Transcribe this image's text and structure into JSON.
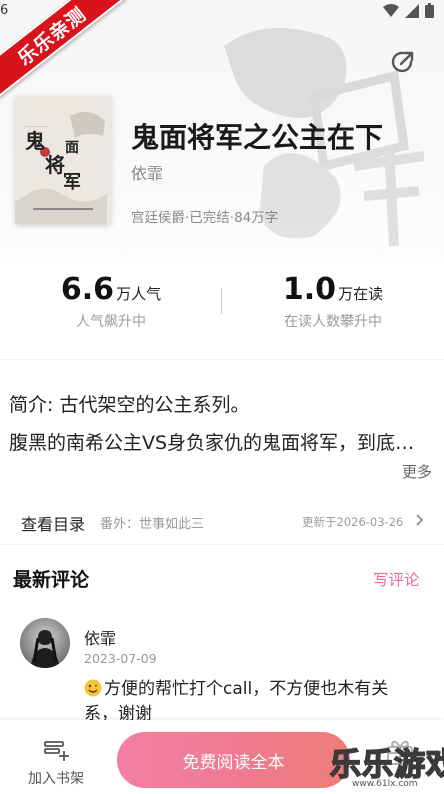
{
  "status": {
    "time_fragment": "6"
  },
  "ribbon": {
    "text": "乐乐亲测"
  },
  "book": {
    "title": "鬼面将军之公主在下",
    "author": "依霏",
    "meta": "宫廷侯爵·已完结·84万字",
    "cover": {
      "calligraphy_1": "鬼",
      "calligraphy_2": "面",
      "calligraphy_3": "将",
      "calligraphy_4": "军"
    }
  },
  "stats": {
    "popularity": {
      "value": "6.6",
      "unit": "万人气",
      "caption": "人气飙升中"
    },
    "reading": {
      "value": "1.0",
      "unit": "万在读",
      "caption": "在读人数攀升中"
    }
  },
  "intro": {
    "summary": "简介: 古代架空的公主系列。",
    "description": "腹黑的南希公主VS身负家仇的鬼面将军，到底谁才是最后的赢家？",
    "more_label": "更多"
  },
  "toc": {
    "title": "查看目录",
    "latest_chapter": "番外：世事如此三",
    "updated": "更新于2026-03-26"
  },
  "reviews": {
    "title": "最新评论",
    "write_label": "写评论",
    "items": [
      {
        "name": "依霏",
        "date": "2023-07-09",
        "text": "方便的帮忙打个call，不方便也木有关系，谢谢"
      }
    ]
  },
  "bottom": {
    "shelf_label": "加入书架",
    "read_label": "免费阅读全本"
  },
  "watermark": {
    "text": "乐乐游戏",
    "url": "www.61lx.com"
  },
  "colors": {
    "ribbon": "#d9131c",
    "accent_pink": "#e96b9f",
    "button_start": "#f47fa5",
    "button_end": "#ef7d76"
  }
}
